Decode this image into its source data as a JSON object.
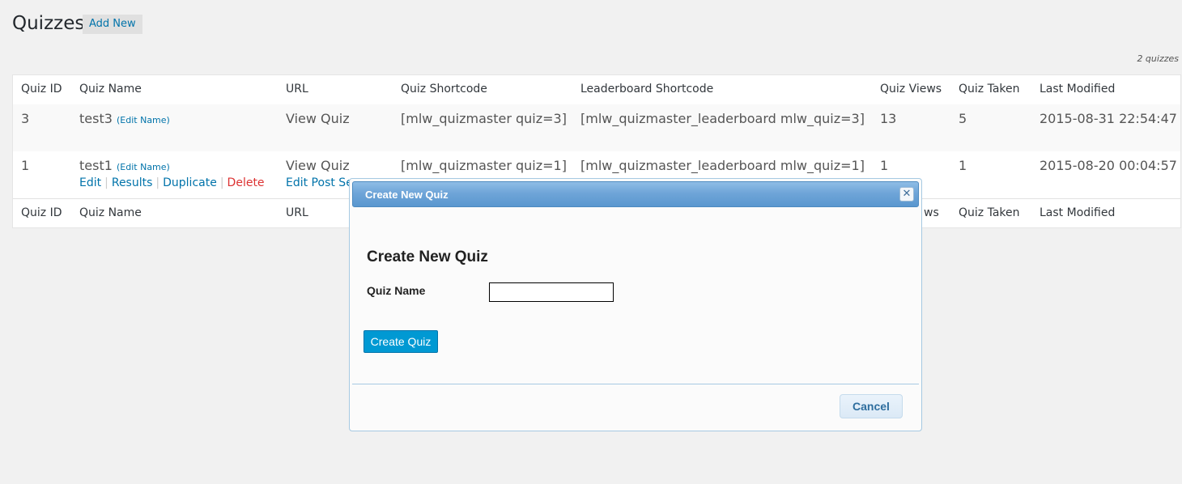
{
  "header": {
    "title": "Quizzes",
    "add_new_label": "Add New",
    "count_label": "2 quizzes"
  },
  "table": {
    "columns": [
      "Quiz ID",
      "Quiz Name",
      "URL",
      "Quiz Shortcode",
      "Leaderboard Shortcode",
      "Quiz Views",
      "Quiz Taken",
      "Last Modified"
    ],
    "rows": [
      {
        "id": "3",
        "name": "test3",
        "edit_name": "(Edit Name)",
        "url_label": "View Quiz",
        "shortcode": "[mlw_quizmaster quiz=3]",
        "leaderboard": "[mlw_quizmaster_leaderboard mlw_quiz=3]",
        "views": "13",
        "taken": "5",
        "modified": "2015-08-31 22:54:47"
      },
      {
        "id": "1",
        "name": "test1",
        "edit_name": "(Edit Name)",
        "url_label": "View Quiz",
        "shortcode": "[mlw_quizmaster quiz=1]",
        "leaderboard": "[mlw_quizmaster_leaderboard mlw_quiz=1]",
        "views": "1",
        "taken": "1",
        "modified": "2015-08-20 00:04:57",
        "actions": {
          "edit": "Edit",
          "results": "Results",
          "duplicate": "Duplicate",
          "delete": "Delete",
          "edit_post": "Edit Post Se",
          "separator": "|"
        }
      }
    ],
    "footer_visible": {
      "views_fragment": "ws"
    }
  },
  "dialog": {
    "title": "Create New Quiz",
    "close_glyph": "✕",
    "heading": "Create New Quiz",
    "field_label": "Quiz Name",
    "field_value": "",
    "create_label": "Create Quiz",
    "cancel_label": "Cancel"
  },
  "colors": {
    "link": "#0073aa",
    "delete": "#dc3232",
    "dialog_title_bar": "#6fa5d8",
    "create_button": "#0099d3"
  }
}
